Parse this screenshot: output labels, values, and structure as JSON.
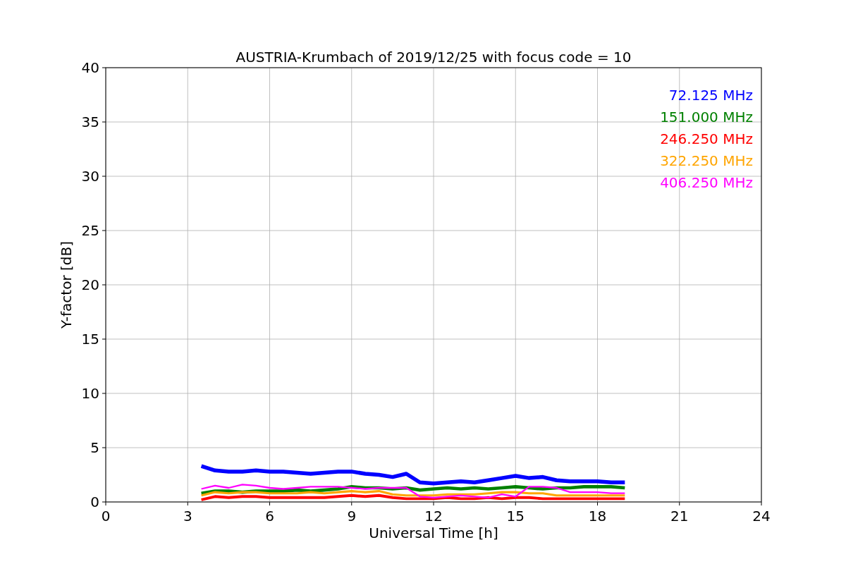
{
  "chart_data": {
    "type": "line",
    "title": "AUSTRIA-Krumbach of 2019/12/25 with focus code = 10",
    "xlabel": "Universal Time [h]",
    "ylabel": "Y-factor [dB]",
    "x": [
      3.5,
      4,
      4.5,
      5,
      5.5,
      6,
      6.5,
      7,
      7.5,
      8,
      8.5,
      9,
      9.5,
      10,
      10.5,
      11,
      11.5,
      12,
      12.5,
      13,
      13.5,
      14,
      14.5,
      15,
      15.5,
      16,
      16.5,
      17,
      17.5,
      18,
      18.5,
      19
    ],
    "series": [
      {
        "name": "72.125 MHz",
        "color": "#0000ff",
        "values": [
          3.3,
          2.9,
          2.8,
          2.8,
          2.9,
          2.8,
          2.8,
          2.7,
          2.6,
          2.7,
          2.8,
          2.8,
          2.6,
          2.5,
          2.3,
          2.6,
          1.8,
          1.7,
          1.8,
          1.9,
          1.8,
          2.0,
          2.2,
          2.4,
          2.2,
          2.3,
          2.0,
          1.9,
          1.9,
          1.9,
          1.8,
          1.8
        ]
      },
      {
        "name": "151.000 MHz",
        "color": "#008000",
        "values": [
          0.8,
          1.0,
          1.0,
          0.9,
          1.0,
          1.0,
          1.0,
          1.1,
          1.0,
          1.1,
          1.2,
          1.4,
          1.3,
          1.3,
          1.2,
          1.3,
          1.1,
          1.2,
          1.3,
          1.2,
          1.3,
          1.2,
          1.3,
          1.4,
          1.3,
          1.2,
          1.3,
          1.3,
          1.4,
          1.4,
          1.4,
          1.3
        ]
      },
      {
        "name": "246.250 MHz",
        "color": "#ff0000",
        "values": [
          0.2,
          0.5,
          0.4,
          0.5,
          0.5,
          0.4,
          0.4,
          0.4,
          0.4,
          0.4,
          0.5,
          0.6,
          0.5,
          0.6,
          0.4,
          0.3,
          0.3,
          0.3,
          0.4,
          0.3,
          0.3,
          0.4,
          0.3,
          0.4,
          0.4,
          0.3,
          0.3,
          0.3,
          0.3,
          0.3,
          0.3,
          0.3
        ]
      },
      {
        "name": "322.250 MHz",
        "color": "#ffa500",
        "values": [
          0.6,
          0.9,
          0.8,
          0.9,
          0.9,
          0.8,
          0.8,
          0.8,
          0.9,
          0.8,
          0.9,
          1.0,
          0.9,
          1.0,
          0.7,
          0.6,
          0.6,
          0.6,
          0.7,
          0.7,
          0.7,
          0.8,
          0.9,
          0.9,
          0.8,
          0.8,
          0.6,
          0.6,
          0.6,
          0.6,
          0.6,
          0.6
        ]
      },
      {
        "name": "406.250 MHz",
        "color": "#ff00ff",
        "values": [
          1.2,
          1.5,
          1.3,
          1.6,
          1.5,
          1.3,
          1.2,
          1.3,
          1.4,
          1.4,
          1.4,
          1.3,
          1.2,
          1.3,
          1.3,
          1.3,
          0.5,
          0.4,
          0.5,
          0.6,
          0.5,
          0.4,
          0.7,
          0.5,
          1.4,
          1.4,
          1.3,
          0.9,
          0.9,
          0.9,
          0.8,
          0.8
        ]
      }
    ],
    "grid": true,
    "xlim": [
      0,
      24
    ],
    "ylim": [
      0,
      40
    ],
    "xticks": [
      0,
      3,
      6,
      9,
      12,
      15,
      18,
      21,
      24
    ],
    "yticks": [
      0,
      5,
      10,
      15,
      20,
      25,
      30,
      35,
      40
    ]
  }
}
